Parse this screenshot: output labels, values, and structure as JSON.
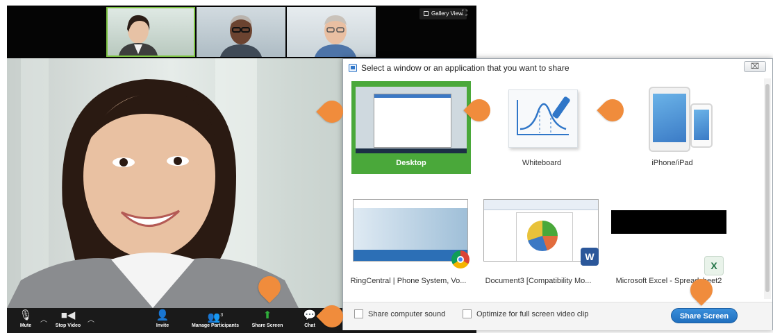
{
  "meeting": {
    "gallery_view_label": "Gallery View",
    "participant_count": "3",
    "toolbar": {
      "mute": "Mute",
      "stop_video": "Stop Video",
      "invite": "Invite",
      "manage_participants": "Manage Participants",
      "share_screen": "Share Screen",
      "chat": "Chat"
    }
  },
  "share_dialog": {
    "title": "Select a window or an application that you want to share",
    "close_glyph": "⌧",
    "items": [
      {
        "label": "Desktop",
        "selected": true
      },
      {
        "label": "Whiteboard",
        "selected": false
      },
      {
        "label": "iPhone/iPad",
        "selected": false
      },
      {
        "label": "RingCentral | Phone System, Vo...",
        "selected": false
      },
      {
        "label": "Document3 [Compatibility Mo...",
        "selected": false
      },
      {
        "label": "Microsoft Excel - Spreadsheet2",
        "selected": false
      }
    ],
    "share_sound_label": "Share computer sound",
    "optimize_label": "Optimize for full screen video clip",
    "share_button_label": "Share Screen"
  },
  "colors": {
    "selected_green": "#4aa83a",
    "callout_orange": "#f08c3c",
    "share_button_blue": "#1f6fbf"
  }
}
